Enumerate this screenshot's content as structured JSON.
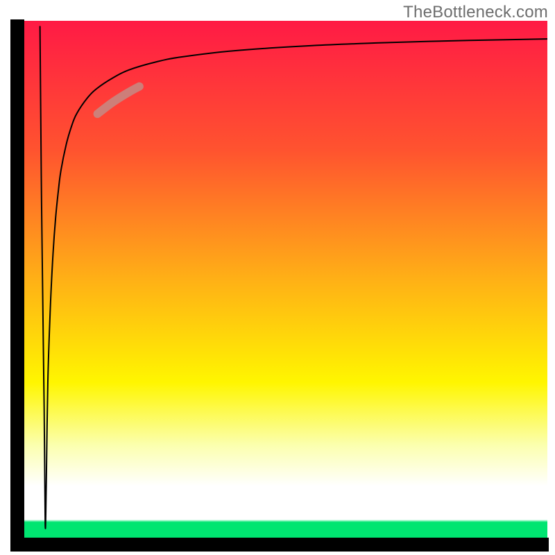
{
  "attribution": "TheBottleneck.com",
  "chart_data": {
    "type": "line",
    "title": "",
    "xlabel": "",
    "ylabel": "",
    "xlim": [
      0,
      100
    ],
    "ylim": [
      0,
      100
    ],
    "grid": false,
    "legend": false,
    "axes_visible": {
      "left": true,
      "bottom": true,
      "top": false,
      "right": false
    },
    "background_gradient": {
      "direction": "vertical",
      "stops": [
        {
          "pos": 0.0,
          "color": "#ff1a45"
        },
        {
          "pos": 0.25,
          "color": "#ff532f"
        },
        {
          "pos": 0.5,
          "color": "#ffb016"
        },
        {
          "pos": 0.7,
          "color": "#fff600"
        },
        {
          "pos": 0.82,
          "color": "#fbffad"
        },
        {
          "pos": 0.9,
          "color": "#ffffff"
        },
        {
          "pos": 0.965,
          "color": "#ffffff"
        },
        {
          "pos": 0.97,
          "color": "#00e571"
        },
        {
          "pos": 1.0,
          "color": "#00e571"
        }
      ]
    },
    "series": [
      {
        "name": "main-curve",
        "stroke": "#000000",
        "stroke_width": 2,
        "x": [
          3.0,
          3.3,
          3.8,
          4.0,
          4.2,
          4.5,
          5.0,
          5.5,
          6.0,
          6.5,
          7.0,
          8.0,
          9.0,
          10.0,
          12.0,
          14.0,
          17.0,
          20.0,
          25.0,
          30.0,
          40.0,
          55.0,
          70.0,
          85.0,
          100.0
        ],
        "y": [
          99.0,
          65.0,
          25.0,
          2.5,
          10.0,
          30.0,
          45.0,
          55.0,
          62.0,
          67.0,
          71.0,
          76.0,
          79.5,
          82.0,
          85.0,
          87.0,
          89.0,
          90.5,
          92.0,
          93.0,
          94.2,
          95.2,
          95.8,
          96.2,
          96.5
        ]
      },
      {
        "name": "highlight-segment",
        "stroke": "#c48b85",
        "stroke_width": 12,
        "linecap": "round",
        "x": [
          14.0,
          17.0,
          20.0,
          22.0
        ],
        "y": [
          82.0,
          84.3,
          86.2,
          87.3
        ]
      }
    ],
    "annotations": []
  },
  "plot_geometry": {
    "outer_w": 800,
    "outer_h": 800,
    "inner_x": 35,
    "inner_y": 30,
    "inner_w": 754,
    "inner_h": 745,
    "axis_stroke": "#000000",
    "axis_width": 20
  }
}
